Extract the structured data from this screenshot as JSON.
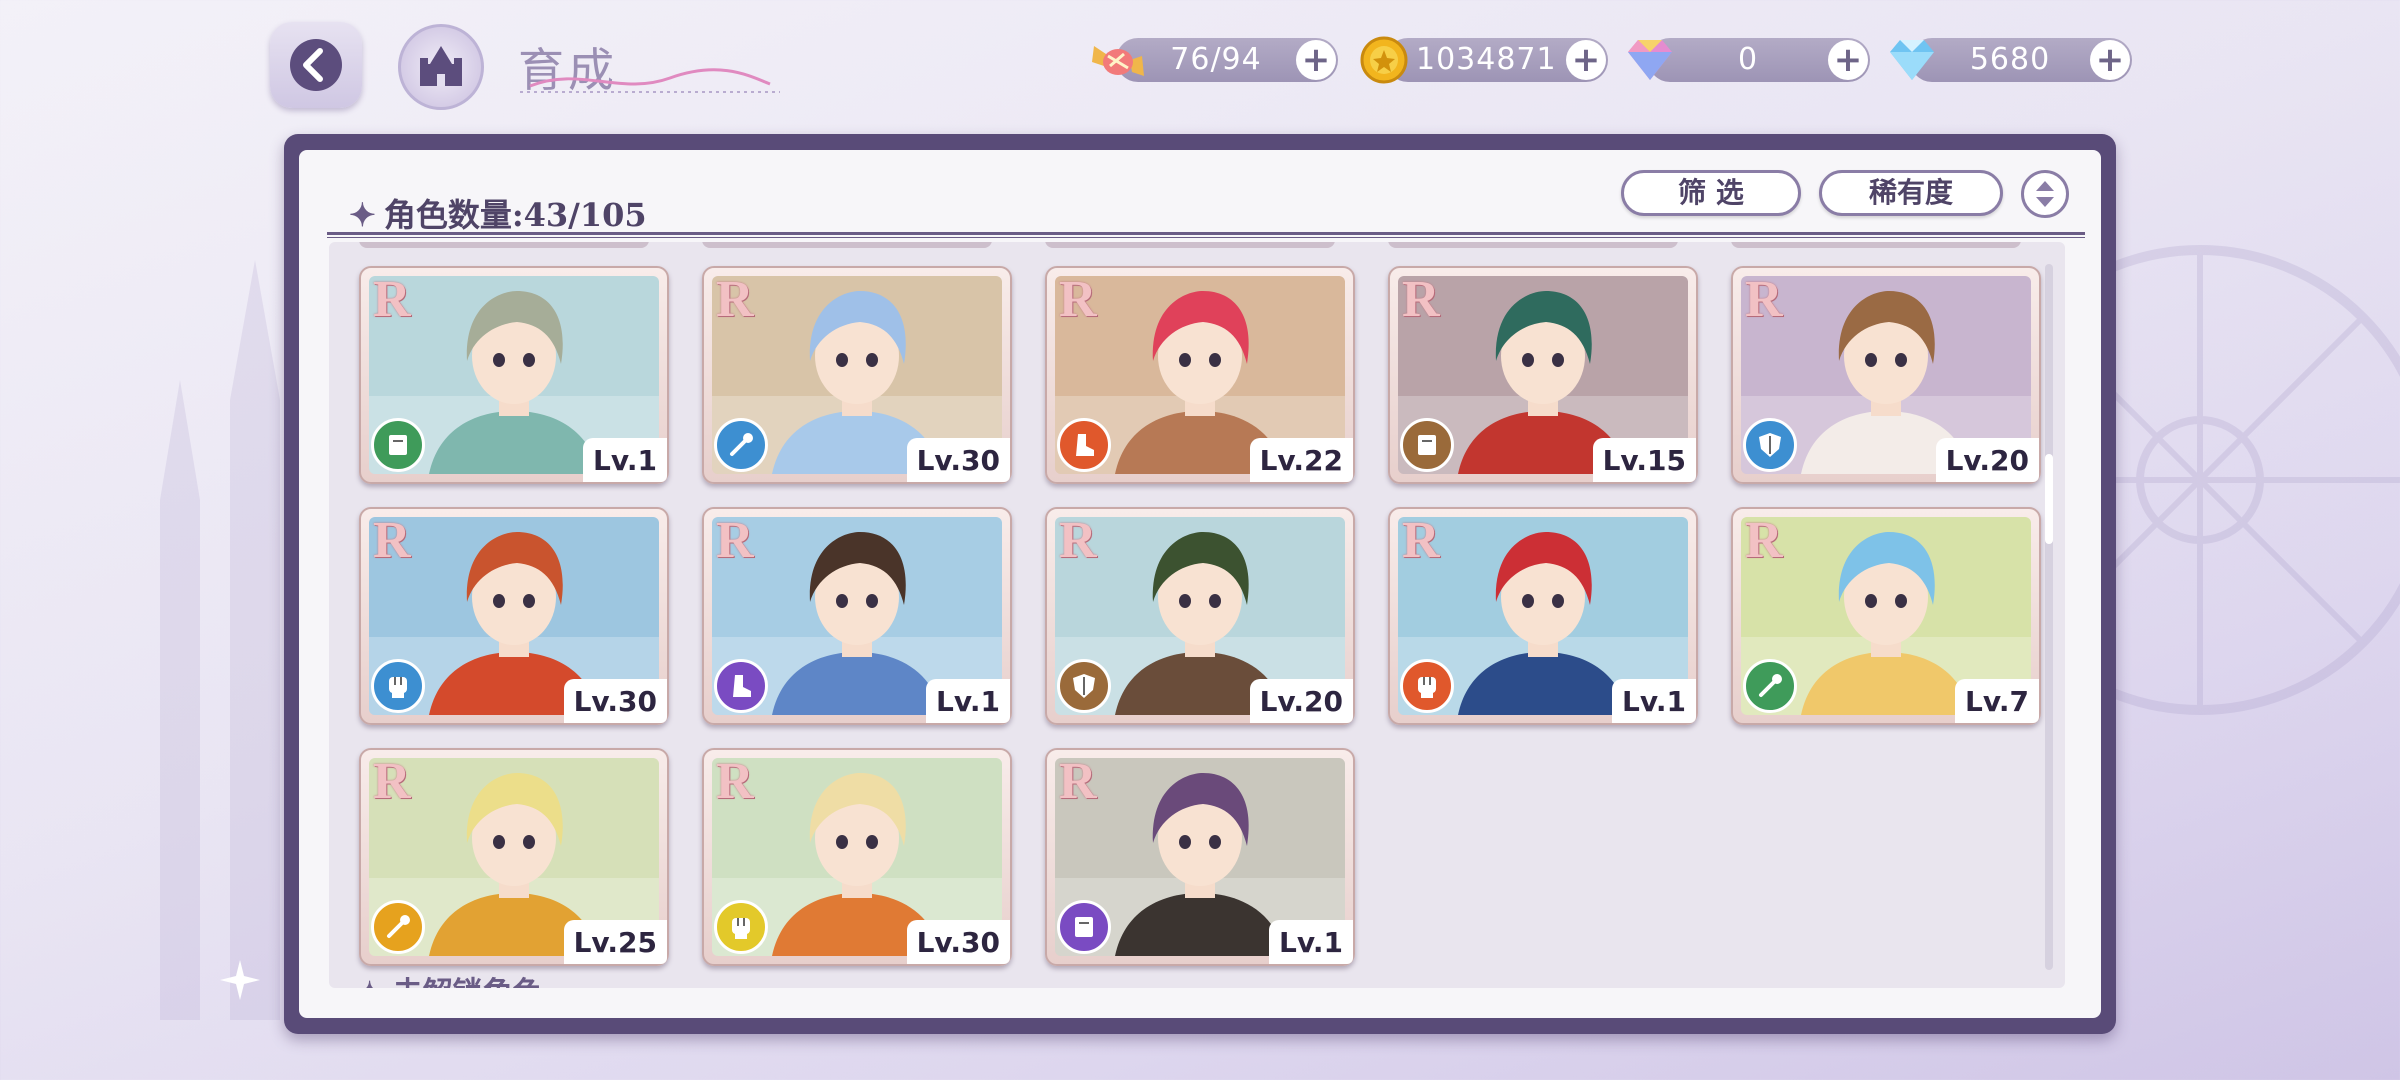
{
  "header": {
    "title": "育成",
    "back_label": "",
    "resources": [
      {
        "name": "stamina",
        "value": "76/94",
        "icon": "candy-icon"
      },
      {
        "name": "gold",
        "value": "1034871",
        "icon": "coin-icon"
      },
      {
        "name": "paid-gem",
        "value": "0",
        "icon": "rainbow-gem-icon"
      },
      {
        "name": "gem",
        "value": "5680",
        "icon": "diamond-icon"
      }
    ]
  },
  "panel": {
    "count_label": "角色数量:43/105",
    "filter_label": "筛 选",
    "sort_label": "稀有度",
    "bottom_section_label": "未解锁角色"
  },
  "cards": [
    {
      "rarity": "R",
      "level": "Lv.1",
      "class_icon": "book-icon",
      "class_color": "#3f9b5a",
      "hair": "#a6ad98",
      "outfit": "#7fb7ae",
      "bg": "#b9d7dc"
    },
    {
      "rarity": "R",
      "level": "Lv.30",
      "class_icon": "wand-icon",
      "class_color": "#3d8fd1",
      "hair": "#9fc0e8",
      "outfit": "#a8c9ea",
      "bg": "#d8c4a8"
    },
    {
      "rarity": "R",
      "level": "Lv.22",
      "class_icon": "boot-icon",
      "class_color": "#e0582c",
      "hair": "#e0415a",
      "outfit": "#b77955",
      "bg": "#d9b89b"
    },
    {
      "rarity": "R",
      "level": "Lv.15",
      "class_icon": "book-icon",
      "class_color": "#9a6a3a",
      "hair": "#2f6b5e",
      "outfit": "#c2362f",
      "bg": "#b9a3a8"
    },
    {
      "rarity": "R",
      "level": "Lv.20",
      "class_icon": "shield-icon",
      "class_color": "#3d8fd1",
      "hair": "#9a6a44",
      "outfit": "#f3ece8",
      "bg": "#c8b5cf"
    },
    {
      "rarity": "R",
      "level": "Lv.30",
      "class_icon": "fist-icon",
      "class_color": "#3d8fd1",
      "hair": "#c9542e",
      "outfit": "#d44a2c",
      "bg": "#9dc6e0"
    },
    {
      "rarity": "R",
      "level": "Lv.1",
      "class_icon": "boot-icon",
      "class_color": "#7a4bc2",
      "hair": "#4a3429",
      "outfit": "#5e86c7",
      "bg": "#a7cde4"
    },
    {
      "rarity": "R",
      "level": "Lv.20",
      "class_icon": "shield-icon",
      "class_color": "#9a6a3a",
      "hair": "#3c5230",
      "outfit": "#6a4d3a",
      "bg": "#b9d6dc"
    },
    {
      "rarity": "R",
      "level": "Lv.1",
      "class_icon": "fist-icon",
      "class_color": "#e0582c",
      "hair": "#cc2f35",
      "outfit": "#2c4c8a",
      "bg": "#a2cde0"
    },
    {
      "rarity": "R",
      "level": "Lv.7",
      "class_icon": "wand-icon",
      "class_color": "#3f9b5a",
      "hair": "#7ec2e8",
      "outfit": "#f0c86a",
      "bg": "#d7e2a8"
    },
    {
      "rarity": "R",
      "level": "Lv.25",
      "class_icon": "wand-icon",
      "class_color": "#e6a21e",
      "hair": "#ecde8a",
      "outfit": "#e2a233",
      "bg": "#d6e0b8"
    },
    {
      "rarity": "R",
      "level": "Lv.30",
      "class_icon": "fist-icon",
      "class_color": "#e3c92a",
      "hair": "#efdda5",
      "outfit": "#e07a34",
      "bg": "#cfe0c2"
    },
    {
      "rarity": "R",
      "level": "Lv.1",
      "class_icon": "book-icon",
      "class_color": "#7a4bc2",
      "hair": "#6a4a7a",
      "outfit": "#3b3430",
      "bg": "#c9c7bd"
    }
  ]
}
